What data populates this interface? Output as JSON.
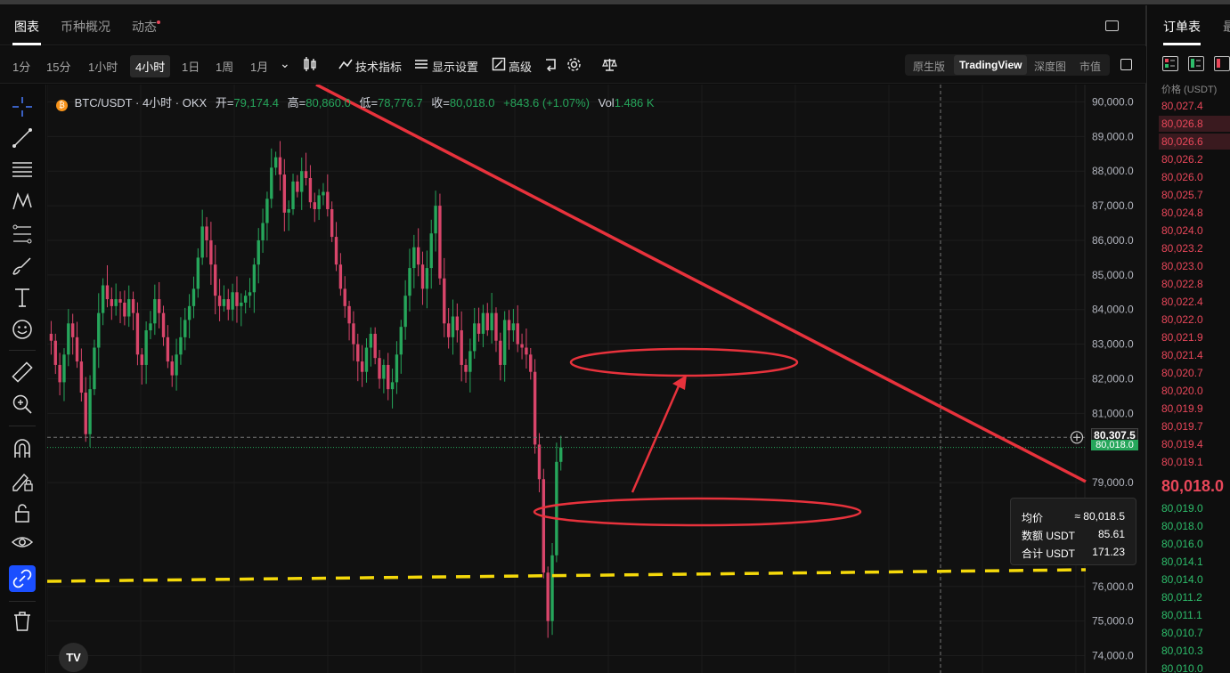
{
  "tabs": [
    {
      "label": "图表",
      "active": true
    },
    {
      "label": "币种概况",
      "active": false
    },
    {
      "label": "动态",
      "active": false
    }
  ],
  "toolbar": {
    "intervals": [
      "1分",
      "15分",
      "1小时",
      "4小时",
      "1日",
      "1周",
      "1月"
    ],
    "active_interval": "4小时",
    "indicators_label": "技术指标",
    "display_label": "显示设置",
    "advanced_label": "高级",
    "views": [
      "原生版",
      "TradingView",
      "深度图",
      "市值"
    ],
    "active_view": "TradingView"
  },
  "legend": {
    "symbol": "BTC/USDT · 4小时 · OKX",
    "open_label": "开=",
    "open": "79,174.4",
    "high_label": "高=",
    "high": "80,860.0",
    "low_label": "低=",
    "low": "78,776.7",
    "close_label": "收=",
    "close": "80,018.0",
    "change": "+843.6 (+1.07%)",
    "vol_label": "Vol",
    "vol": "1.486 K"
  },
  "chart_data": {
    "type": "candlestick",
    "y_axis_ticks": [
      "90,000.0",
      "89,000.0",
      "88,000.0",
      "87,000.0",
      "86,000.0",
      "85,000.0",
      "84,000.0",
      "83,000.0",
      "82,000.0",
      "81,000.0",
      "79,000.0",
      "76,000.0",
      "75,000.0",
      "74,000.0"
    ],
    "ylim": [
      73500,
      90500
    ],
    "crosshair_price": "80,307.5",
    "last_price_tag": "80,018.0",
    "closes": [
      83100,
      82400,
      81900,
      82700,
      83600,
      83200,
      82500,
      81600,
      80400,
      81700,
      82900,
      83900,
      84700,
      84300,
      84100,
      84300,
      84200,
      83800,
      84300,
      83900,
      82700,
      82400,
      83400,
      83600,
      84300,
      83900,
      83200,
      82500,
      82100,
      82700,
      83200,
      83700,
      84100,
      84600,
      85500,
      86400,
      86000,
      85300,
      84400,
      84100,
      84300,
      84000,
      84500,
      84100,
      84200,
      84400,
      84500,
      85300,
      86000,
      86500,
      87200,
      88100,
      88400,
      87900,
      86800,
      86900,
      87700,
      87400,
      88000,
      87800,
      87100,
      86900,
      87300,
      87400,
      86900,
      86100,
      85300,
      84600,
      84100,
      83600,
      83000,
      82500,
      82200,
      82900,
      83300,
      82600,
      82000,
      82400,
      81700,
      81900,
      82700,
      83500,
      84400,
      85200,
      85800,
      85300,
      84600,
      85200,
      86200,
      87000,
      84900,
      83600,
      83200,
      83800,
      83400,
      82400,
      82200,
      82800,
      83600,
      83300,
      83900,
      83400,
      83900,
      83100,
      82400,
      83700,
      83400,
      83600,
      83000,
      82900,
      82700,
      82200,
      80100,
      79100,
      76400,
      75000,
      76900,
      79600,
      80018
    ],
    "annotations": {
      "downtrend_line": {
        "from": [
          0,
          90500
        ],
        "to": [
          118,
          79000
        ]
      },
      "support_line": 76000,
      "ellipse_upper": 82400,
      "ellipse_lower": 78500
    }
  },
  "tooltip": {
    "avg_label": "均价",
    "avg_value": "≈ 80,018.5",
    "amount_label": "数额 USDT",
    "amount_value": "85.61",
    "total_label": "合计 USDT",
    "total_value": "171.23"
  },
  "orderbook": {
    "title": "订单表",
    "title2": "最",
    "price_header": "价格 (USDT)",
    "asks": [
      "80,027.4",
      "80,026.8",
      "80,026.6",
      "80,026.2",
      "80,026.0",
      "80,025.7",
      "80,024.8",
      "80,024.0",
      "80,023.2",
      "80,023.0",
      "80,022.8",
      "80,022.4",
      "80,022.0",
      "80,021.9",
      "80,021.4",
      "80,020.7",
      "80,020.0",
      "80,019.9",
      "80,019.7",
      "80,019.4",
      "80,019.1"
    ],
    "last": "80,018.0",
    "bids": [
      "80,019.0",
      "80,018.0",
      "80,016.0",
      "80,014.1",
      "80,014.0",
      "80,011.2",
      "80,011.1",
      "80,010.7",
      "80,010.3",
      "80,010.0"
    ]
  },
  "colors": {
    "up": "#26a65b",
    "down": "#d8456a",
    "trend": "#e8323c",
    "support": "#f5d90a",
    "accent": "#1b4fff"
  },
  "tv_logo": "TV"
}
